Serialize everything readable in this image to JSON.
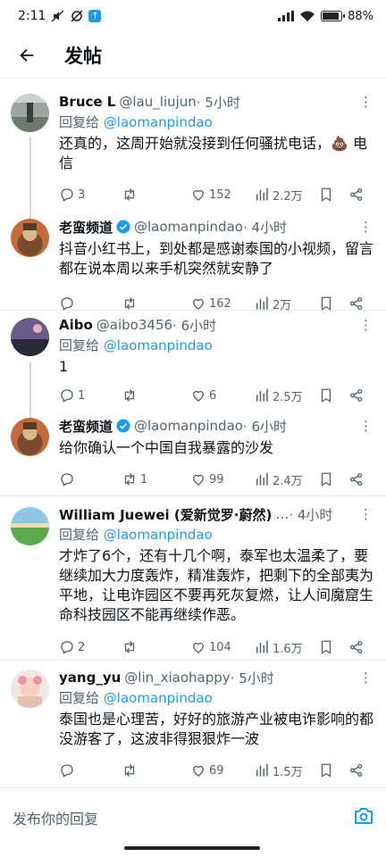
{
  "status_bar": {
    "time": "2:11",
    "battery_pct": "88%",
    "battery_level": 0.88
  },
  "header": {
    "title": "发帖"
  },
  "tweets": [
    {
      "name": "Bruce L",
      "handle": "@lau_liujun",
      "time": "· 5小时",
      "reply_prefix": "回复给",
      "reply_to": "@laomanpindao",
      "body": "还真的，这周开始就没接到任何骚扰电话，💩 电信",
      "replies": "3",
      "retweets": "",
      "likes": "152",
      "views": "2.2万"
    },
    {
      "name": "老蛮频道",
      "handle": "@laomanpindao",
      "time": "· 4小时",
      "body": "抖音小红书上，到处都是感谢泰国的小视频，留言都在说本周以来手机突然就安静了",
      "replies": "",
      "retweets": "",
      "likes": "162",
      "views": "2万"
    },
    {
      "name": "Aibo",
      "handle": "@aibo3456",
      "time": "· 6小时",
      "reply_prefix": "回复给",
      "reply_to": "@laomanpindao",
      "body": "1",
      "replies": "1",
      "retweets": "",
      "likes": "6",
      "views": "2.5万"
    },
    {
      "name": "老蛮频道",
      "handle": "@laomanpindao",
      "time": "· 6小时",
      "body": "给你确认一个中国自我暴露的沙发",
      "replies": "",
      "retweets": "1",
      "likes": "99",
      "views": "2.4万"
    },
    {
      "name": "William Juewei (爱新觉罗·蔚然)",
      "handle": "…",
      "time": "· 4小时",
      "reply_prefix": "回复给",
      "reply_to": "@laomanpindao",
      "body": "才炸了6个，还有十几个啊，泰军也太温柔了，要继续加大力度轰炸，精准轰炸，把剩下的全部夷为平地，让电诈园区不要再死灰复燃，让人间魔窟生命科技园区不能再继续作恶。",
      "replies": "2",
      "retweets": "",
      "likes": "104",
      "views": "1.6万"
    },
    {
      "name": "yang_yu",
      "handle": "@lin_xiaohappy",
      "time": "· 5小时",
      "reply_prefix": "回复给",
      "reply_to": "@laomanpindao",
      "body": "泰国也是心理苦，好好的旅游产业被电诈影响的都没游客了，这波非得狠狠炸一波",
      "replies": "",
      "retweets": "",
      "likes": "69",
      "views": "1.5万"
    }
  ],
  "composer": {
    "placeholder": "发布你的回复"
  },
  "colors": {
    "accent": "#1d9bf0",
    "text": "#0f1419",
    "muted": "#536471"
  }
}
